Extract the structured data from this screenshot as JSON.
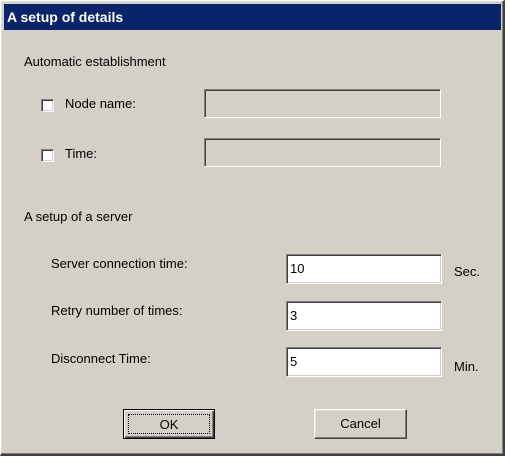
{
  "window": {
    "title": "A setup of details"
  },
  "auto": {
    "group_label": "Automatic establishment",
    "node_name_label": "Node name:",
    "node_name_checked": false,
    "node_name_value": "",
    "time_label": "Time:",
    "time_checked": false,
    "time_value": ""
  },
  "server": {
    "group_label": "A setup of a server",
    "connection_time_label": "Server connection time:",
    "connection_time_value": "10",
    "connection_time_unit": "Sec.",
    "retry_label": "Retry number of times:",
    "retry_value": "3",
    "disconnect_label": "Disconnect Time:",
    "disconnect_value": "5",
    "disconnect_unit": "Min."
  },
  "buttons": {
    "ok_label": "OK",
    "cancel_label": "Cancel"
  },
  "colors": {
    "titlebar": "#0a246a",
    "face": "#d4d0c8"
  }
}
